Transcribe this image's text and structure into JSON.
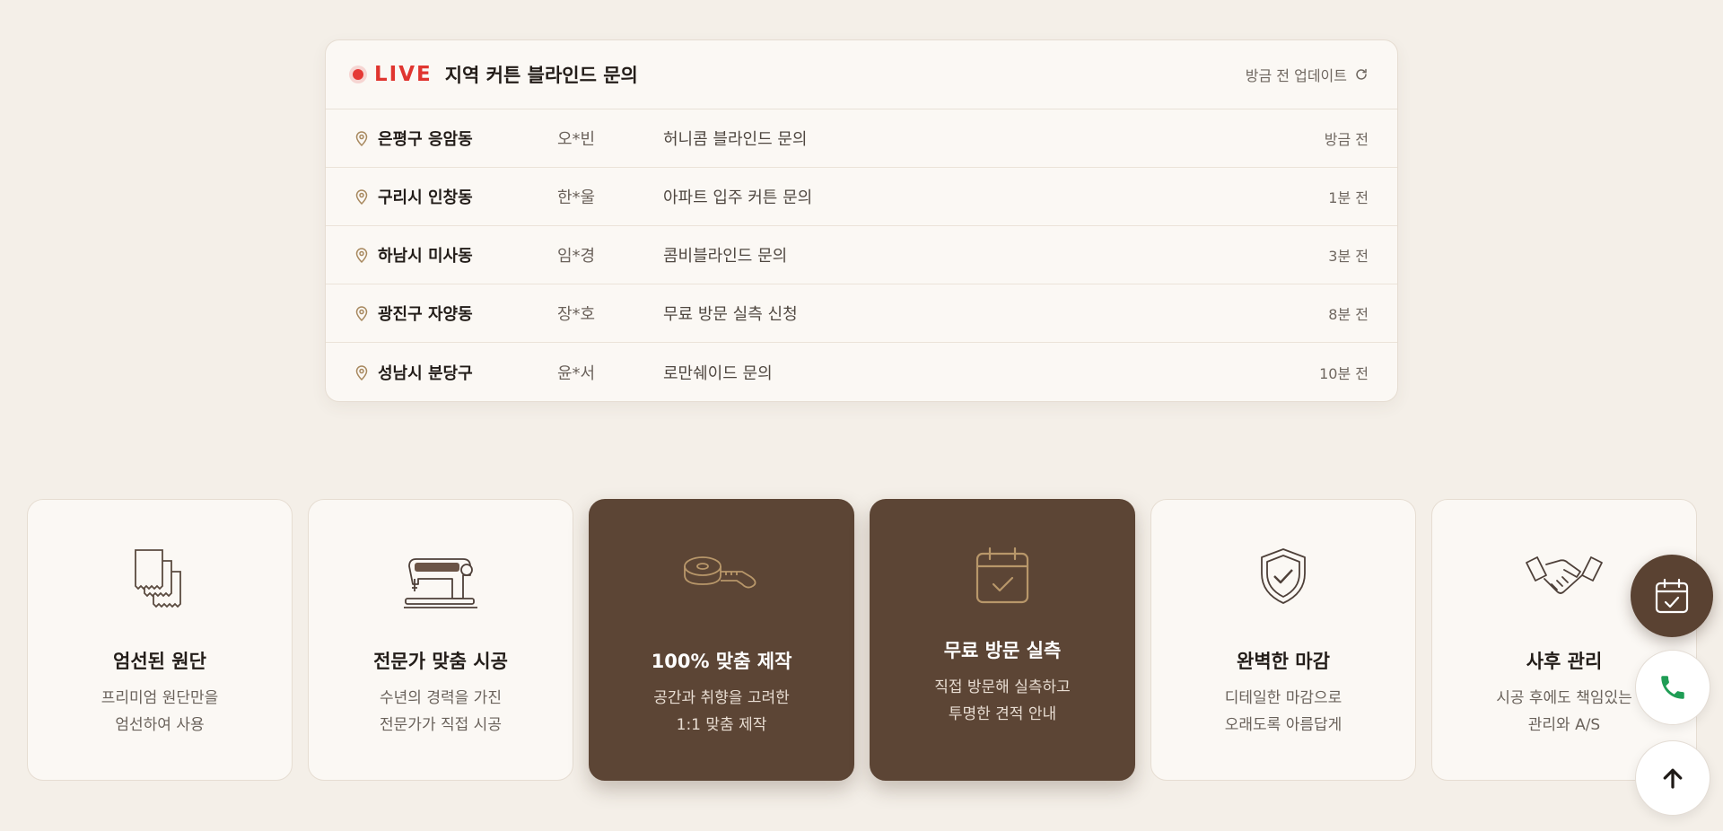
{
  "live": {
    "badge": "LIVE",
    "title": "지역 커튼 블라인드 문의",
    "updated": "방금 전 업데이트",
    "rows": [
      {
        "area": "은평구 응암동",
        "name": "오*빈",
        "type": "허니콤 블라인드 문의",
        "time": "방금 전"
      },
      {
        "area": "구리시 인창동",
        "name": "한*울",
        "type": "아파트 입주 커튼 문의",
        "time": "1분 전"
      },
      {
        "area": "하남시 미사동",
        "name": "임*경",
        "type": "콤비블라인드 문의",
        "time": "3분 전"
      },
      {
        "area": "광진구 자양동",
        "name": "장*호",
        "type": "무료 방문 실측 신청",
        "time": "8분 전"
      },
      {
        "area": "성남시 분당구",
        "name": "윤*서",
        "type": "로만쉐이드 문의",
        "time": "10분 전"
      }
    ]
  },
  "features": [
    {
      "icon": "fabric-swatch-icon",
      "title": "엄선된 원단",
      "desc1": "프리미엄 원단만을",
      "desc2": "엄선하여 사용"
    },
    {
      "icon": "sewing-machine-icon",
      "title": "전문가 맞춤 시공",
      "desc1": "수년의 경력을 가진",
      "desc2": "전문가가 직접 시공"
    },
    {
      "icon": "measuring-tape-icon",
      "title": "100% 맞춤 제작",
      "desc1": "공간과 취향을 고려한",
      "desc2": "1:1 맞춤 제작"
    },
    {
      "icon": "calendar-check-icon",
      "title": "무료 방문 실측",
      "desc1": "직접 방문해 실측하고",
      "desc2": "투명한 견적 안내"
    },
    {
      "icon": "shield-check-icon",
      "title": "완벽한 마감",
      "desc1": "디테일한 마감으로",
      "desc2": "오래도록 아름답게"
    },
    {
      "icon": "handshake-icon",
      "title": "사후 관리",
      "desc1": "시공 후에도 책임있는",
      "desc2": "관리와 A/S"
    }
  ],
  "colors": {
    "accent": "#5c4535",
    "live_red": "#e53935",
    "gold": "#b8976a",
    "phone_green": "#1f9d55",
    "background": "#f4efe8"
  },
  "fabs": {
    "reserve_icon": "calendar-check-icon",
    "phone_icon": "phone-icon",
    "top_icon": "arrow-up-icon"
  }
}
